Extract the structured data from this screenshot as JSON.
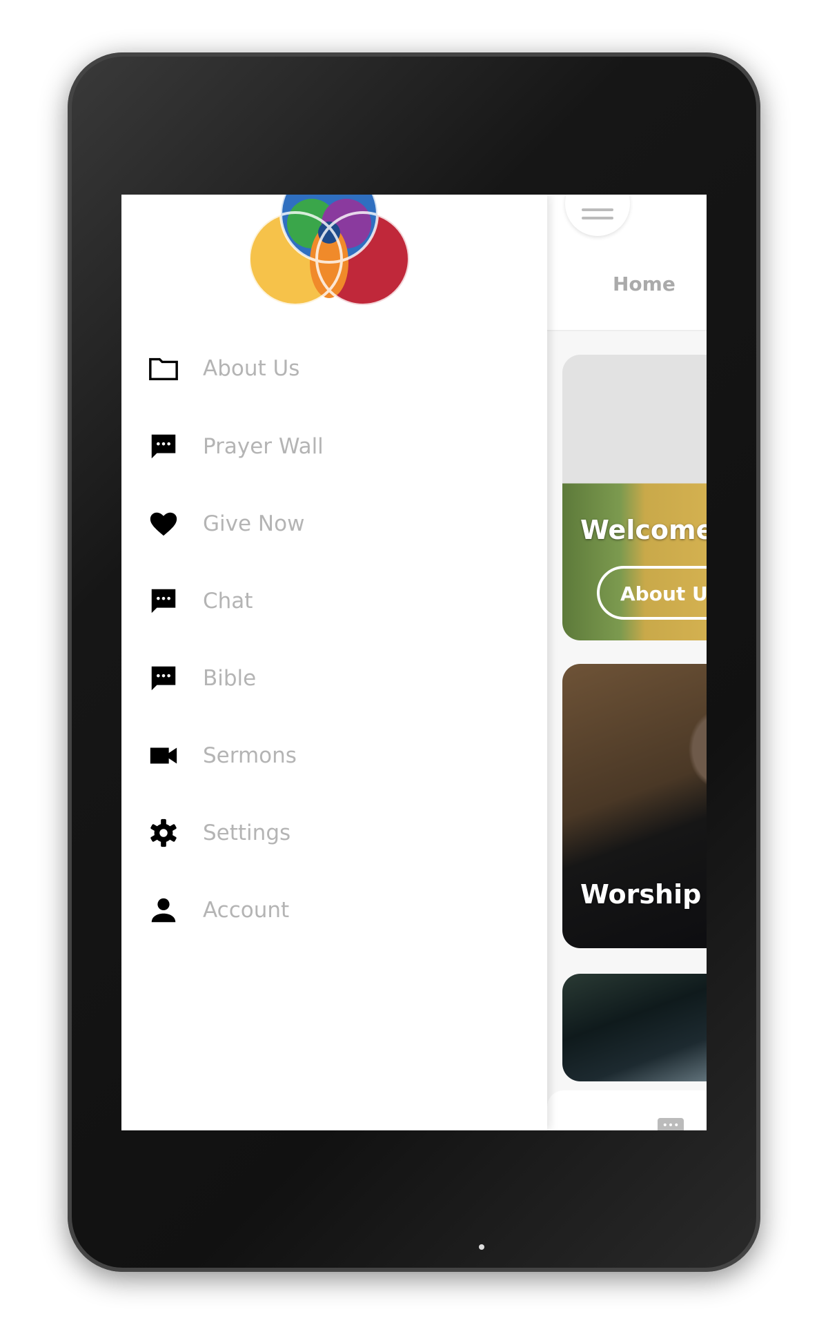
{
  "drawer": {
    "items": [
      {
        "label": "About Us",
        "icon": "folder-icon"
      },
      {
        "label": "Prayer Wall",
        "icon": "chat-icon"
      },
      {
        "label": "Give Now",
        "icon": "heart-icon"
      },
      {
        "label": "Chat",
        "icon": "chat-icon"
      },
      {
        "label": "Bible",
        "icon": "chat-icon"
      },
      {
        "label": "Sermons",
        "icon": "video-camera-icon"
      },
      {
        "label": "Settings",
        "icon": "gear-icon"
      },
      {
        "label": "Account",
        "icon": "person-icon"
      }
    ]
  },
  "header": {
    "title": "Home"
  },
  "cards": [
    {
      "title": "Welcome",
      "button": "About Us"
    },
    {
      "title": "Worship"
    },
    {
      "title": ""
    }
  ],
  "colors": {
    "logo": [
      "#f6c24a",
      "#2f6fc0",
      "#c0283a",
      "#3aa64a",
      "#8a3a9e",
      "#f08a2a"
    ],
    "menu_text": "#b4b4b4"
  }
}
